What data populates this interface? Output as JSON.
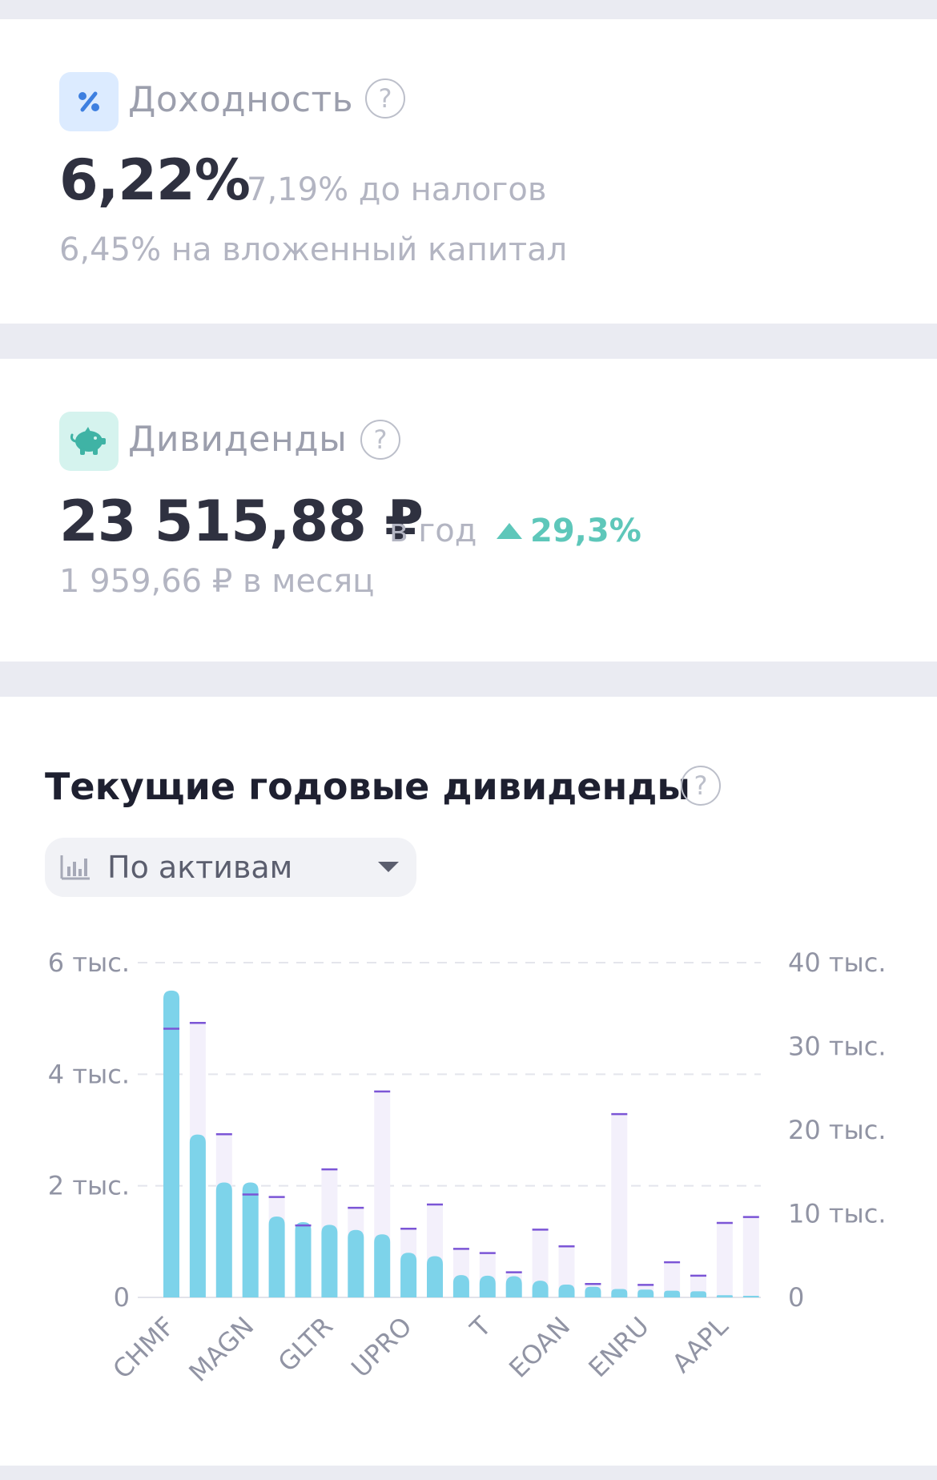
{
  "yield": {
    "title": "Доходность",
    "icon": "percent-icon",
    "value": "6,22%",
    "before_tax": "7,19% до налогов",
    "on_capital": "6,45% на вложенный капитал",
    "help": "?"
  },
  "dividends": {
    "title": "Дивиденды",
    "icon": "piggy-bank-icon",
    "value": "23 515,88 ₽",
    "per_year": "в год",
    "change": "29,3%",
    "per_month": "1 959,66 ₽ в месяц",
    "help": "?"
  },
  "chart_section": {
    "title": "Текущие годовые дивиденды",
    "help": "?",
    "dropdown_label": "По активам",
    "dropdown_icon": "bar-chart-icon"
  },
  "colors": {
    "bar": "#7dd3ea",
    "ghost": "#f3f0fb",
    "marker": "#7b55d6",
    "accent_green": "#5ec7ba",
    "accent_blue": "#3d7fe0"
  },
  "chart_data": {
    "type": "bar",
    "left_axis": {
      "ticks": [
        "0",
        "2 тыс.",
        "4 тыс.",
        "6 тыс."
      ],
      "ylim": [
        0,
        6000
      ]
    },
    "right_axis": {
      "ticks": [
        "0",
        "10 тыс.",
        "20 тыс.",
        "30 тыс.",
        "40 тыс."
      ],
      "ylim": [
        0,
        40000
      ]
    },
    "x_labels": [
      {
        "index": 0,
        "label": "CHMF"
      },
      {
        "index": 3,
        "label": "MAGN"
      },
      {
        "index": 6,
        "label": "GLTR"
      },
      {
        "index": 9,
        "label": "UPRO"
      },
      {
        "index": 12,
        "label": "T"
      },
      {
        "index": 15,
        "label": "EOAN"
      },
      {
        "index": 18,
        "label": "ENRU"
      },
      {
        "index": 21,
        "label": "AAPL"
      }
    ],
    "series": [
      {
        "name": "dividends",
        "axis": "left",
        "values": [
          5500,
          2920,
          2060,
          2060,
          1450,
          1350,
          1300,
          1210,
          1130,
          800,
          740,
          400,
          390,
          380,
          300,
          230,
          190,
          150,
          140,
          120,
          110,
          40,
          20
        ]
      },
      {
        "name": "value",
        "axis": "right",
        "values": [
          32100,
          32800,
          19500,
          12300,
          12000,
          8600,
          15300,
          10700,
          24600,
          8200,
          11100,
          5800,
          5300,
          3000,
          8100,
          6100,
          1600,
          21900,
          1500,
          4200,
          2600,
          8900,
          9600
        ]
      }
    ],
    "grid": true
  }
}
